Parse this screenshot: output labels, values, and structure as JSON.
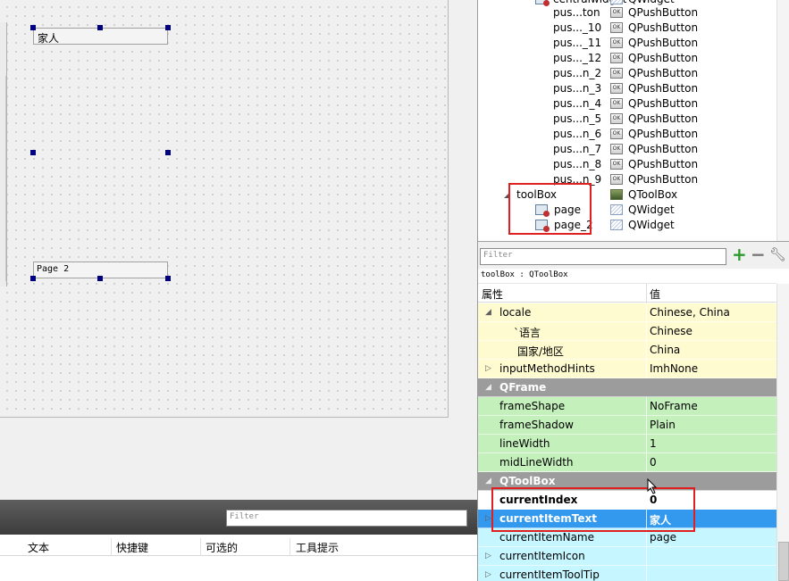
{
  "canvas": {
    "toolbox_tabs": [
      "家人",
      "Page 2"
    ]
  },
  "action_editor": {
    "filter_placeholder": "Filter",
    "columns": [
      "文本",
      "快捷键",
      "可选的",
      "工具提示"
    ]
  },
  "object_inspector": {
    "partial_top": {
      "name": "centralwidget",
      "class": "QWidget"
    },
    "buttons": [
      {
        "name": "pus...ton",
        "class": "QPushButton"
      },
      {
        "name": "pus..._10",
        "class": "QPushButton"
      },
      {
        "name": "pus..._11",
        "class": "QPushButton"
      },
      {
        "name": "pus..._12",
        "class": "QPushButton"
      },
      {
        "name": "pus...n_2",
        "class": "QPushButton"
      },
      {
        "name": "pus...n_3",
        "class": "QPushButton"
      },
      {
        "name": "pus...n_4",
        "class": "QPushButton"
      },
      {
        "name": "pus...n_5",
        "class": "QPushButton"
      },
      {
        "name": "pus...n_6",
        "class": "QPushButton"
      },
      {
        "name": "pus...n_7",
        "class": "QPushButton"
      },
      {
        "name": "pus...n_8",
        "class": "QPushButton"
      },
      {
        "name": "pus...n_9",
        "class": "QPushButton"
      }
    ],
    "toolbox": {
      "name": "toolBox",
      "class": "QToolBox"
    },
    "pages": [
      {
        "name": "page",
        "class": "QWidget"
      },
      {
        "name": "page_2",
        "class": "QWidget"
      }
    ],
    "pushbutton_icon_text": "OK"
  },
  "property_editor": {
    "filter_placeholder": "Filter",
    "object_label": "toolBox : QToolBox",
    "header": {
      "property": "属性",
      "value": "值"
    },
    "rows": [
      {
        "prop": "locale",
        "value": "Chinese, China"
      },
      {
        "prop": "`语言",
        "value": "Chinese"
      },
      {
        "prop": "国家/地区",
        "value": "China"
      },
      {
        "prop": "inputMethodHints",
        "value": "ImhNone"
      },
      {
        "prop": "QFrame",
        "value": ""
      },
      {
        "prop": "frameShape",
        "value": "NoFrame"
      },
      {
        "prop": "frameShadow",
        "value": "Plain"
      },
      {
        "prop": "lineWidth",
        "value": "1"
      },
      {
        "prop": "midLineWidth",
        "value": "0"
      },
      {
        "prop": "QToolBox",
        "value": ""
      },
      {
        "prop": "currentIndex",
        "value": "0"
      },
      {
        "prop": "currentItemText",
        "value": "家人"
      },
      {
        "prop": "currentItemName",
        "value": "page"
      },
      {
        "prop": "currentItemIcon",
        "value": ""
      },
      {
        "prop": "currentItemToolTip",
        "value": ""
      }
    ]
  },
  "colors": {
    "selection": "#3399ee",
    "highlight_box": "#e02020",
    "yellow_rows": "#fffbd0",
    "green_rows": "#c4f0bc",
    "cyan_rows": "#c6f6ff",
    "group_header": "#9c9c9c"
  }
}
